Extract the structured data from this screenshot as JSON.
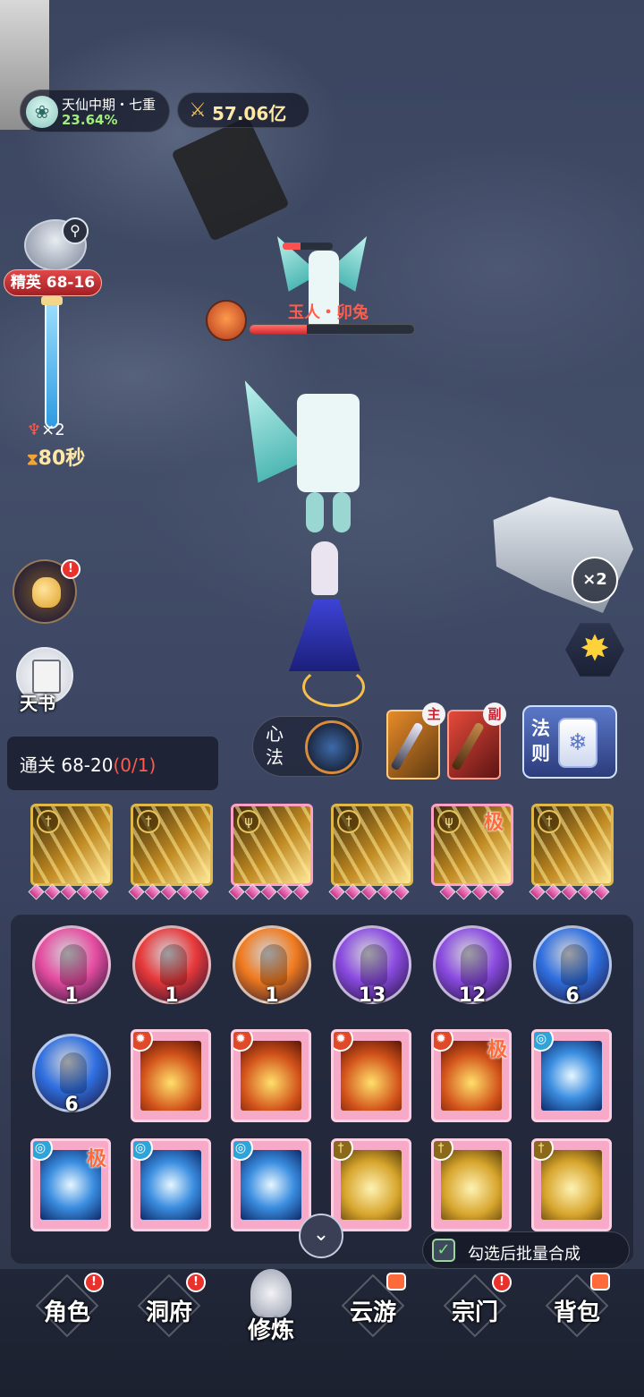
{
  "hud": {
    "realm_name": "天仙中期・七重",
    "realm_progress": "23.64%",
    "power_value": "57.06亿"
  },
  "stage": {
    "badge": "精英 68-16",
    "multiplier": "×2",
    "timer": "80秒"
  },
  "boss": {
    "name": "玉人・卯兔",
    "hp_fraction": 0.35,
    "minion_hp_fraction": 0.35
  },
  "left_buttons": {
    "book_label": "天书",
    "alert": "!"
  },
  "right_buttons": {
    "speed": "×2"
  },
  "skill_row": {
    "xinfa_label": "心法",
    "main_tag": "主",
    "sub_tag": "副",
    "fa_label": "法则"
  },
  "clear_goal": {
    "text": "通关 68-20",
    "progress": "(0/1)"
  },
  "equipped_cards": [
    {
      "ji": ""
    },
    {
      "ji": ""
    },
    {
      "ji": ""
    },
    {
      "ji": ""
    },
    {
      "ji": "极"
    },
    {
      "ji": ""
    }
  ],
  "inventory": {
    "orbs": [
      {
        "count": "1",
        "color": "#e54ca0"
      },
      {
        "count": "1",
        "color": "#e8383a"
      },
      {
        "count": "1",
        "color": "#f07a1e"
      },
      {
        "count": "13",
        "color": "#8a4ae0"
      },
      {
        "count": "12",
        "color": "#8a4ae0"
      },
      {
        "count": "6",
        "color": "#2f6fe0"
      },
      {
        "count": "6",
        "color": "#2f6fe0"
      }
    ],
    "ji_label": "极",
    "batch_label": "勾选后批量合成"
  },
  "nav": {
    "items": [
      "角色",
      "洞府",
      "修炼",
      "云游",
      "宗门",
      "背包"
    ],
    "active": "修炼"
  }
}
